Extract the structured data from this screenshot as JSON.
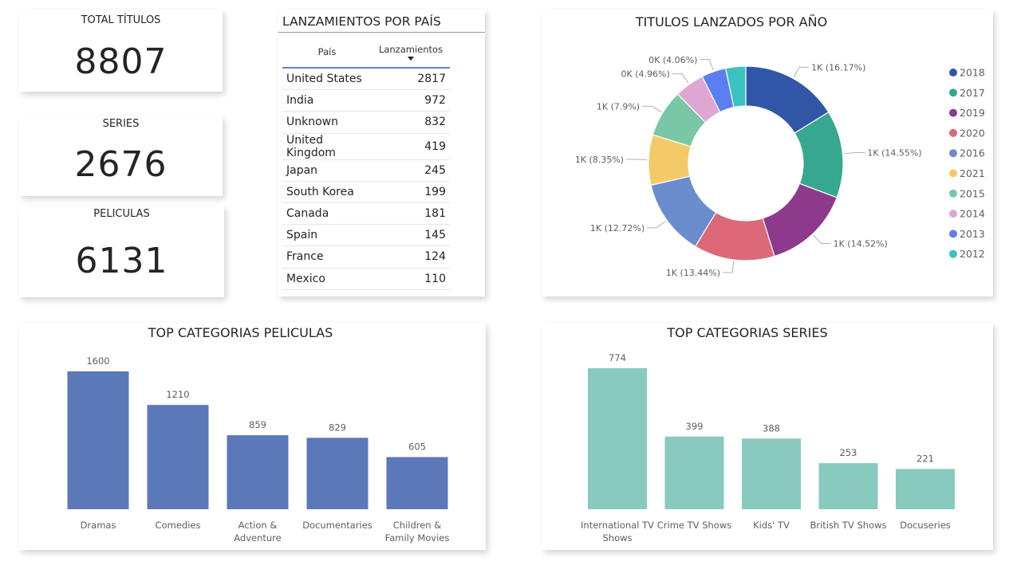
{
  "kpis": {
    "total": {
      "label": "TOTAL TÍTULOS",
      "value": "8807"
    },
    "series": {
      "label": "SERIES",
      "value": "2676"
    },
    "peliculas": {
      "label": "PELICULAS",
      "value": "6131"
    }
  },
  "country_table": {
    "title": "LANZAMIENTOS POR PAÍS",
    "columns": [
      "País",
      "Lanzamientos"
    ],
    "sort_column": "Lanzamientos",
    "rows": [
      [
        "United States",
        "2817"
      ],
      [
        "India",
        "972"
      ],
      [
        "Unknown",
        "832"
      ],
      [
        "United Kingdom",
        "419"
      ],
      [
        "Japan",
        "245"
      ],
      [
        "South Korea",
        "199"
      ],
      [
        "Canada",
        "181"
      ],
      [
        "Spain",
        "145"
      ],
      [
        "France",
        "124"
      ],
      [
        "Mexico",
        "110"
      ]
    ]
  },
  "colors": {
    "movies_bar": "#5b78b9",
    "series_bar": "#88cbbe"
  },
  "chart_data": [
    {
      "type": "pie",
      "title": "TITULOS LANZADOS POR AÑO",
      "legend_position": "right",
      "slices": [
        {
          "label": "2018",
          "percent": 16.17,
          "data_label": "1K (16.17%)",
          "color": "#3156a8"
        },
        {
          "label": "2017",
          "percent": 14.55,
          "data_label": "1K (14.55%)",
          "color": "#37a78f"
        },
        {
          "label": "2019",
          "percent": 14.52,
          "data_label": "1K (14.52%)",
          "color": "#8d3a8c"
        },
        {
          "label": "2020",
          "percent": 13.44,
          "data_label": "1K (13.44%)",
          "color": "#dc6878"
        },
        {
          "label": "2016",
          "percent": 12.72,
          "data_label": "1K (12.72%)",
          "color": "#6a8ecd"
        },
        {
          "label": "2021",
          "percent": 8.35,
          "data_label": "1K (8.35%)",
          "color": "#f4ca69"
        },
        {
          "label": "2015",
          "percent": 7.9,
          "data_label": "1K (7.9%)",
          "color": "#79c7a5"
        },
        {
          "label": "2014",
          "percent": 4.96,
          "data_label": "0K (4.96%)",
          "color": "#dea6d2"
        },
        {
          "label": "2013",
          "percent": 4.06,
          "data_label": "0K (4.06%)",
          "color": "#5c7ef0"
        },
        {
          "label": "2012",
          "percent": 3.33,
          "data_label": "",
          "color": "#3cc2c0"
        }
      ]
    },
    {
      "type": "bar",
      "title": "TOP CATEGORIAS PELICULAS",
      "categories": [
        "Dramas",
        "Comedies",
        "Action & Adventure",
        "Documentaries",
        "Children & Family Movies"
      ],
      "category_lines": [
        [
          "Dramas"
        ],
        [
          "Comedies"
        ],
        [
          "Action &",
          "Adventure"
        ],
        [
          "Documentaries"
        ],
        [
          "Children &",
          "Family Movies"
        ]
      ],
      "values": [
        1600,
        1210,
        859,
        829,
        605
      ],
      "ylim": [
        0,
        1600
      ]
    },
    {
      "type": "bar",
      "title": "TOP CATEGORIAS SERIES",
      "categories": [
        "International TV Shows",
        "Crime TV Shows",
        "Kids' TV",
        "British TV Shows",
        "Docuseries"
      ],
      "category_lines": [
        [
          "International TV",
          "Shows"
        ],
        [
          "Crime TV Shows"
        ],
        [
          "Kids' TV"
        ],
        [
          "British TV Shows"
        ],
        [
          "Docuseries"
        ]
      ],
      "values": [
        774,
        399,
        388,
        253,
        221
      ],
      "ylim": [
        0,
        774
      ]
    }
  ]
}
